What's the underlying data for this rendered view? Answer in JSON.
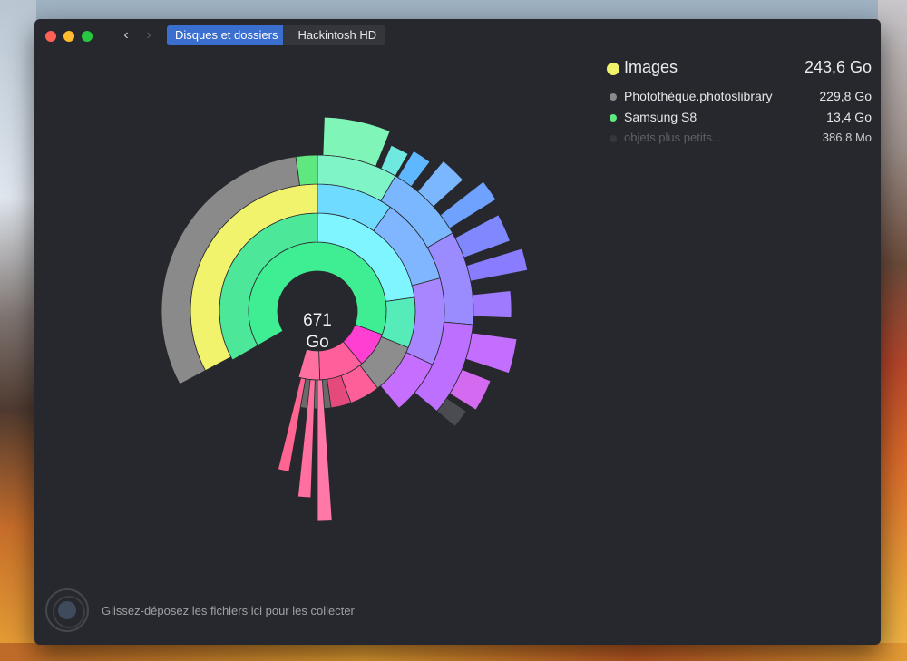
{
  "window": {
    "breadcrumbs": [
      "Disques et dossiers",
      "Hackintosh HD"
    ]
  },
  "sunburst": {
    "center_value": "671",
    "center_unit": "Go"
  },
  "legend": {
    "selected": {
      "name": "Images",
      "size": "243,6 Go",
      "color": "#f2f36c"
    },
    "items": [
      {
        "name": "Photothèque.photoslibrary",
        "size": "229,8 Go",
        "color": "#8a8a8a"
      },
      {
        "name": "Samsung S8",
        "size": "13,4 Go",
        "color": "#5fe87f"
      },
      {
        "name": "objets plus petits...",
        "size": "386,8  Mo",
        "color": "#35373c"
      }
    ]
  },
  "dropzone": {
    "hint": "Glissez-déposez les fichiers ici pour les collecter"
  }
}
